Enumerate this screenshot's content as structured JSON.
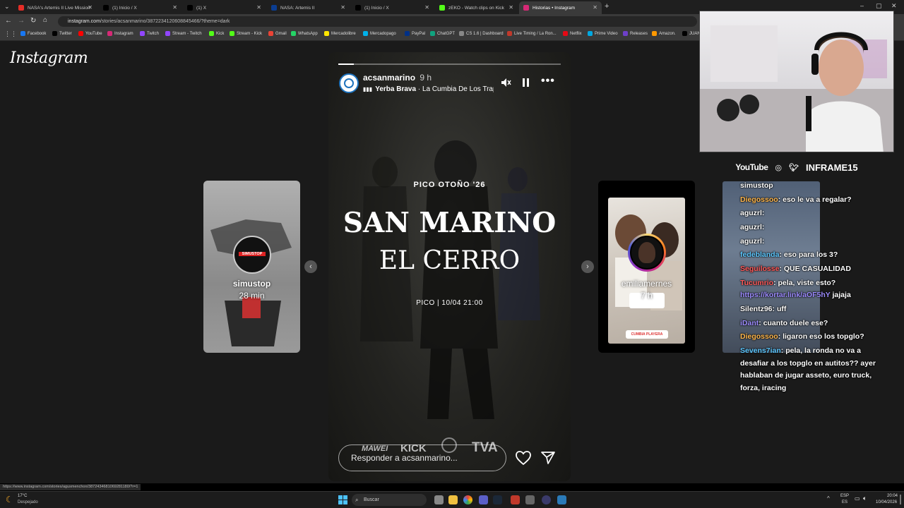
{
  "tabs": [
    {
      "label": "NASA's Artemis II Live Mission",
      "fav": "red-circle-icon",
      "color": "#e52d27"
    },
    {
      "label": "(1) Inicio / X",
      "fav": "x-icon",
      "color": "#000000"
    },
    {
      "label": "(1) X",
      "fav": "x-icon",
      "color": "#000000"
    },
    {
      "label": "NASA: Artemis II",
      "fav": "nasa-icon",
      "color": "#0b3d91"
    },
    {
      "label": "(1) Inicio / X",
      "fav": "x-icon",
      "color": "#000000"
    },
    {
      "label": "zEKO - Watch clips on Kick",
      "fav": "kick-icon",
      "color": "#53fc18"
    },
    {
      "label": "Historias • Instagram",
      "fav": "instagram-icon",
      "color": "#d62976"
    }
  ],
  "address": {
    "host": "instagram.com",
    "path": "/stories/acsanmarino/3872234120608845466/?theme=dark"
  },
  "bookmarks": [
    {
      "label": "Facebook",
      "color": "#1877f2"
    },
    {
      "label": "Twitter",
      "color": "#000000"
    },
    {
      "label": "YouTube",
      "color": "#ff0000"
    },
    {
      "label": "Instagram",
      "color": "#d62976"
    },
    {
      "label": "Twitch",
      "color": "#9146ff"
    },
    {
      "label": "Stream - Twitch",
      "color": "#9146ff"
    },
    {
      "label": "Kick",
      "color": "#53fc18"
    },
    {
      "label": "Stream - Kick",
      "color": "#53fc18"
    },
    {
      "label": "Gmail",
      "color": "#ea4335"
    },
    {
      "label": "WhatsApp",
      "color": "#25d366"
    },
    {
      "label": "Mercadolibre",
      "color": "#ffe600"
    },
    {
      "label": "Mercadopago",
      "color": "#00b1ea"
    },
    {
      "label": "PayPal",
      "color": "#003087"
    },
    {
      "label": "ChatGPT",
      "color": "#10a37f"
    },
    {
      "label": "CS 1.6 | Dashboard",
      "color": "#888888"
    },
    {
      "label": "Live Timing / La Ron...",
      "color": "#c0392b"
    },
    {
      "label": "Netflix",
      "color": "#e50914"
    },
    {
      "label": "Prime Video",
      "color": "#00a8e1"
    },
    {
      "label": "Releases",
      "color": "#6e40c9"
    },
    {
      "label": "Amazon.",
      "color": "#ff9900"
    },
    {
      "label": "JUAN",
      "color": "#000000"
    }
  ],
  "instagram_logo": "Instagram",
  "left_story": {
    "user": "simustop",
    "time": "28 min",
    "avatar_text": "SIMUSTOP"
  },
  "right_story": {
    "user": "emiliamernes",
    "time": "7 h",
    "sticker": "CUMBIA PLAYERA"
  },
  "story": {
    "user": "acsanmarino",
    "time": "9 h",
    "song_title": "Yerba Brava",
    "song_artist": "La Cumbia De Los Trap",
    "kicker": "PICO OTOÑO '26",
    "title_line1": "SAN MARINO",
    "title_line2": "EL CERRO",
    "date_line": "PICO | 10/04 21:00",
    "reply_placeholder": "Responder a acsanmarino...",
    "sponsors": [
      "MAWEI",
      "KICK",
      "TVA"
    ]
  },
  "stream": {
    "socials": [
      "YouTube",
      "INFRAME15"
    ],
    "chat": [
      {
        "user": "simustop",
        "msg": "",
        "color": "#ffffff"
      },
      {
        "user": "Diegossoo",
        "msg": ": eso le va a regalar?",
        "color": "#ffb74d"
      },
      {
        "user": "aguzrl",
        "msg": ": ",
        "color": "#ffffff"
      },
      {
        "user": "aguzrl",
        "msg": ": ",
        "color": "#ffffff"
      },
      {
        "user": "aguzrl",
        "msg": ": ",
        "color": "#ffffff"
      },
      {
        "user": "fedeblanda",
        "msg": ": eso para los 3?",
        "color": "#5ec8ff"
      },
      {
        "user": "Seguilosse",
        "msg": ": QUE CASUALIDAD",
        "color": "#ff5a5a"
      },
      {
        "user": "Tucumrio",
        "msg": ": pela, viste esto?",
        "color": "#ff5a5a"
      },
      {
        "user": "https://kortar.link/aOF5hY",
        "msg": " jajaja",
        "color": "#9d8cff"
      },
      {
        "user": "Silentz96",
        "msg": ": uff",
        "color": "#ffffff"
      },
      {
        "user": "iDant",
        "msg": ": cuanto duele ese?",
        "color": "#9d8cff"
      },
      {
        "user": "Diegossoo",
        "msg": ": ligaron eso los topglo?",
        "color": "#ffb74d"
      },
      {
        "user": "Sevens7ian",
        "msg": ": pela, la ronda no va a",
        "color": "#5ec8ff"
      },
      {
        "user": "",
        "msg": "desafiar a los topglo en autitos?? ayer",
        "color": "#ffffff"
      },
      {
        "user": "",
        "msg": "hablaban de jugar asseto, euro truck,",
        "color": "#ffffff"
      },
      {
        "user": "",
        "msg": "forza, iracing",
        "color": "#ffffff"
      }
    ]
  },
  "status_url": "https://www.instagram.com/stories/agusmenchon/3872434681069281180/?r=1",
  "taskbar": {
    "weather_temp": "17°C",
    "weather_desc": "Despejado",
    "search": "Buscar",
    "lang": "ESP",
    "lang_sub": "ES",
    "time": "20:04",
    "date": "10/04/2026"
  }
}
